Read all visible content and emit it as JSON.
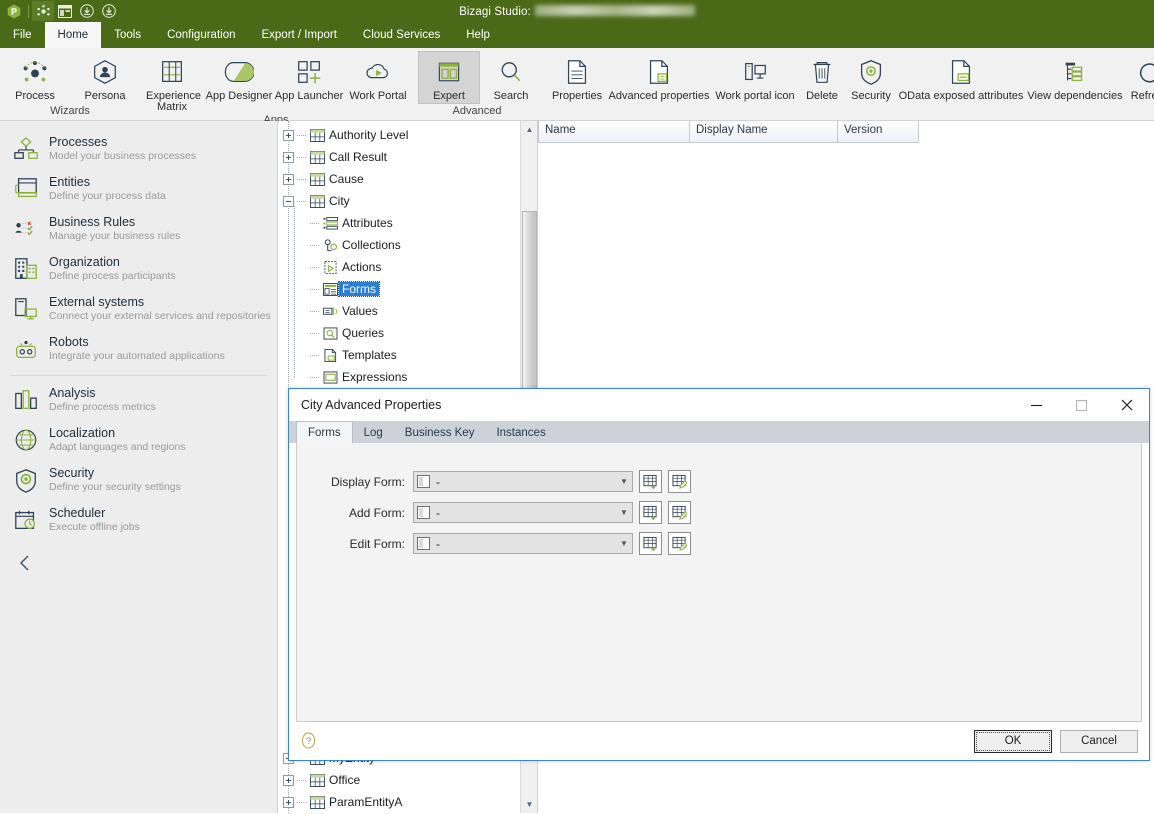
{
  "titlebar": {
    "app_title": "Bizagi Studio:",
    "quick_access": [
      {
        "name": "bizagi-logo-icon",
        "label": "Bizagi"
      },
      {
        "name": "process-wizard-icon",
        "label": "Process"
      },
      {
        "name": "work-portal-icon",
        "label": "Work Portal"
      },
      {
        "name": "download-icon",
        "label": "Download"
      },
      {
        "name": "upload-icon",
        "label": "Publish"
      }
    ]
  },
  "menubar": {
    "items": [
      {
        "label": "File",
        "active": false
      },
      {
        "label": "Home",
        "active": true
      },
      {
        "label": "Tools",
        "active": false
      },
      {
        "label": "Configuration",
        "active": false
      },
      {
        "label": "Export / Import",
        "active": false
      },
      {
        "label": "Cloud Services",
        "active": false
      },
      {
        "label": "Help",
        "active": false
      }
    ]
  },
  "ribbon": {
    "groups": [
      {
        "label": "Wizards",
        "buttons": [
          {
            "label": "Process",
            "icon": "process-icon",
            "selected": false
          },
          {
            "label": "Persona",
            "icon": "persona-icon",
            "selected": false
          }
        ]
      },
      {
        "label": "Apps",
        "buttons": [
          {
            "label": "Experience Matrix",
            "icon": "experience-matrix-icon",
            "selected": false
          },
          {
            "label": "App Designer",
            "icon": "app-designer-icon",
            "selected": false
          },
          {
            "label": "App Launcher",
            "icon": "app-launcher-icon",
            "selected": false
          },
          {
            "label": "Work Portal",
            "icon": "work-portal-cloud-icon",
            "selected": false
          }
        ]
      },
      {
        "label": "Advanced",
        "buttons": [
          {
            "label": "Expert",
            "icon": "expert-icon",
            "selected": true
          },
          {
            "label": "Search",
            "icon": "search-icon",
            "selected": false
          }
        ]
      },
      {
        "label": "",
        "buttons": [
          {
            "label": "Properties",
            "icon": "properties-icon",
            "selected": false
          },
          {
            "label": "Advanced properties",
            "icon": "advanced-properties-icon",
            "selected": false
          },
          {
            "label": "Work portal icon",
            "icon": "work-portal-icon-icon",
            "selected": false
          },
          {
            "label": "Delete",
            "icon": "delete-icon",
            "selected": false
          },
          {
            "label": "Security",
            "icon": "security-shield-icon",
            "selected": false
          },
          {
            "label": "OData exposed attributes",
            "icon": "odata-icon",
            "selected": false
          },
          {
            "label": "View dependencies",
            "icon": "view-dependencies-icon",
            "selected": false
          },
          {
            "label": "Refresh",
            "icon": "refresh-icon",
            "selected": false
          }
        ]
      }
    ]
  },
  "sidebar": {
    "items": [
      {
        "title": "Processes",
        "subtitle": "Model your business processes",
        "icon": "processes-icon"
      },
      {
        "title": "Entities",
        "subtitle": "Define your process data",
        "icon": "entities-icon"
      },
      {
        "title": "Business Rules",
        "subtitle": "Manage your business rules",
        "icon": "business-rules-icon"
      },
      {
        "title": "Organization",
        "subtitle": "Define process participants",
        "icon": "organization-icon"
      },
      {
        "title": "External systems",
        "subtitle": "Connect your external services and repositories",
        "icon": "external-systems-icon"
      },
      {
        "title": "Robots",
        "subtitle": "Integrate your automated applications",
        "icon": "robots-icon"
      }
    ],
    "items_secondary": [
      {
        "title": "Analysis",
        "subtitle": "Define process metrics",
        "icon": "analysis-icon"
      },
      {
        "title": "Localization",
        "subtitle": "Adapt languages and regions",
        "icon": "localization-icon"
      },
      {
        "title": "Security",
        "subtitle": "Define your security settings",
        "icon": "security-icon"
      },
      {
        "title": "Scheduler",
        "subtitle": "Execute offline jobs",
        "icon": "scheduler-icon"
      }
    ],
    "collapse": {
      "icon": "chevron-left-icon",
      "label": "Collapse"
    }
  },
  "tree": {
    "top_nodes": [
      {
        "label": "Authority Level",
        "state": "collapsed",
        "icon": "entity-icon"
      },
      {
        "label": "Call Result",
        "state": "collapsed",
        "icon": "entity-icon"
      },
      {
        "label": "Cause",
        "state": "collapsed",
        "icon": "entity-icon"
      },
      {
        "label": "City",
        "state": "expanded",
        "icon": "entity-icon"
      }
    ],
    "city_children": [
      {
        "label": "Attributes",
        "icon": "attributes-icon",
        "selected": false
      },
      {
        "label": "Collections",
        "icon": "collections-icon",
        "selected": false
      },
      {
        "label": "Actions",
        "icon": "actions-icon",
        "selected": false
      },
      {
        "label": "Forms",
        "icon": "forms-icon",
        "selected": true
      },
      {
        "label": "Values",
        "icon": "values-icon",
        "selected": false
      },
      {
        "label": "Queries",
        "icon": "queries-icon",
        "selected": false
      },
      {
        "label": "Templates",
        "icon": "templates-icon",
        "selected": false
      },
      {
        "label": "Expressions",
        "icon": "expressions-icon",
        "selected": false
      }
    ],
    "bottom_nodes": [
      {
        "label": "MyEntity",
        "state": "collapsed",
        "icon": "entity-icon"
      },
      {
        "label": "Office",
        "state": "collapsed",
        "icon": "entity-icon"
      },
      {
        "label": "ParamEntityA",
        "state": "collapsed",
        "icon": "entity-icon"
      }
    ],
    "scroll": {
      "up": "scroll-up-arrow",
      "down": "scroll-down-arrow"
    }
  },
  "grid": {
    "columns": [
      "Name",
      "Display Name",
      "Version"
    ],
    "rows": []
  },
  "dialog": {
    "title": "City Advanced Properties",
    "window_buttons": [
      {
        "name": "minimize-button",
        "glyph": "–"
      },
      {
        "name": "maximize-button",
        "glyph": "□"
      },
      {
        "name": "close-button",
        "glyph": "✕"
      }
    ],
    "tabs": [
      {
        "label": "Forms",
        "active": true
      },
      {
        "label": "Log",
        "active": false
      },
      {
        "label": "Business Key",
        "active": false
      },
      {
        "label": "Instances",
        "active": false
      }
    ],
    "fields": [
      {
        "label": "Display Form:",
        "value": "-",
        "add_icon": "add-form-icon",
        "edit_icon": "edit-form-icon"
      },
      {
        "label": "Add Form:",
        "value": "-",
        "add_icon": "add-form-icon",
        "edit_icon": "edit-form-icon"
      },
      {
        "label": "Edit Form:",
        "value": "-",
        "add_icon": "add-form-icon",
        "edit_icon": "edit-form-icon"
      }
    ],
    "help_icon": "help-question-icon",
    "buttons": {
      "ok": "OK",
      "cancel": "Cancel"
    }
  },
  "colors": {
    "brand_green": "#4b6a18",
    "accent_green": "#8cb33a",
    "dark_navy": "#2e4356",
    "selection_blue": "#2a7fd4",
    "dialog_border": "#3a86c8"
  }
}
